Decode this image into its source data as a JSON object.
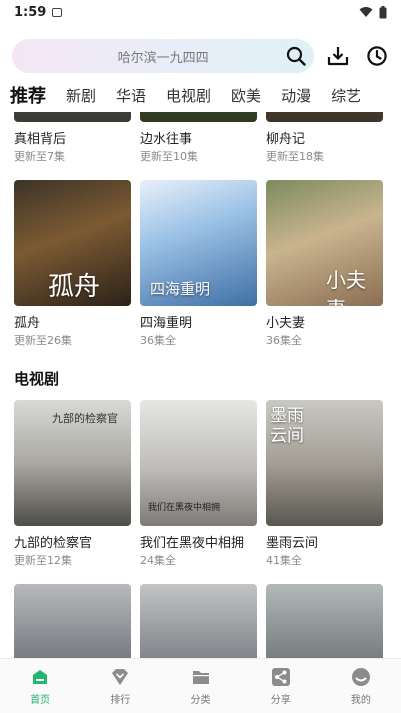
{
  "status": {
    "time": "1:59"
  },
  "search": {
    "placeholder": "哈尔滨一九四四"
  },
  "tabs": [
    "推荐",
    "新剧",
    "华语",
    "电视剧",
    "欧美",
    "动漫",
    "综艺"
  ],
  "row0": [
    {
      "title": "真相背后",
      "sub": "更新至7集"
    },
    {
      "title": "边水往事",
      "sub": "更新至10集"
    },
    {
      "title": "柳舟记",
      "sub": "更新至18集"
    }
  ],
  "row1": [
    {
      "title": "孤舟",
      "sub": "更新至26集",
      "poster_text": "孤舟"
    },
    {
      "title": "四海重明",
      "sub": "36集全",
      "poster_text": "四海重明"
    },
    {
      "title": "小夫妻",
      "sub": "36集全",
      "poster_text": "小夫妻"
    }
  ],
  "section_tv": {
    "title": "电视剧"
  },
  "row2": [
    {
      "title": "九部的检察官",
      "sub": "更新至12集",
      "poster_text": "九部的检察官"
    },
    {
      "title": "我们在黑夜中相拥",
      "sub": "24集全",
      "poster_text": "我们在黑夜中相拥"
    },
    {
      "title": "墨雨云间",
      "sub": "41集全",
      "poster_text": "墨雨云间"
    }
  ],
  "tabbar": [
    {
      "label": "首页",
      "icon": "home-icon"
    },
    {
      "label": "排行",
      "icon": "rank-icon"
    },
    {
      "label": "分类",
      "icon": "category-icon"
    },
    {
      "label": "分享",
      "icon": "share-icon"
    },
    {
      "label": "我的",
      "icon": "profile-icon"
    }
  ],
  "colors": {
    "accent": "#22b573",
    "tab_dot": "#ef4d4d"
  }
}
